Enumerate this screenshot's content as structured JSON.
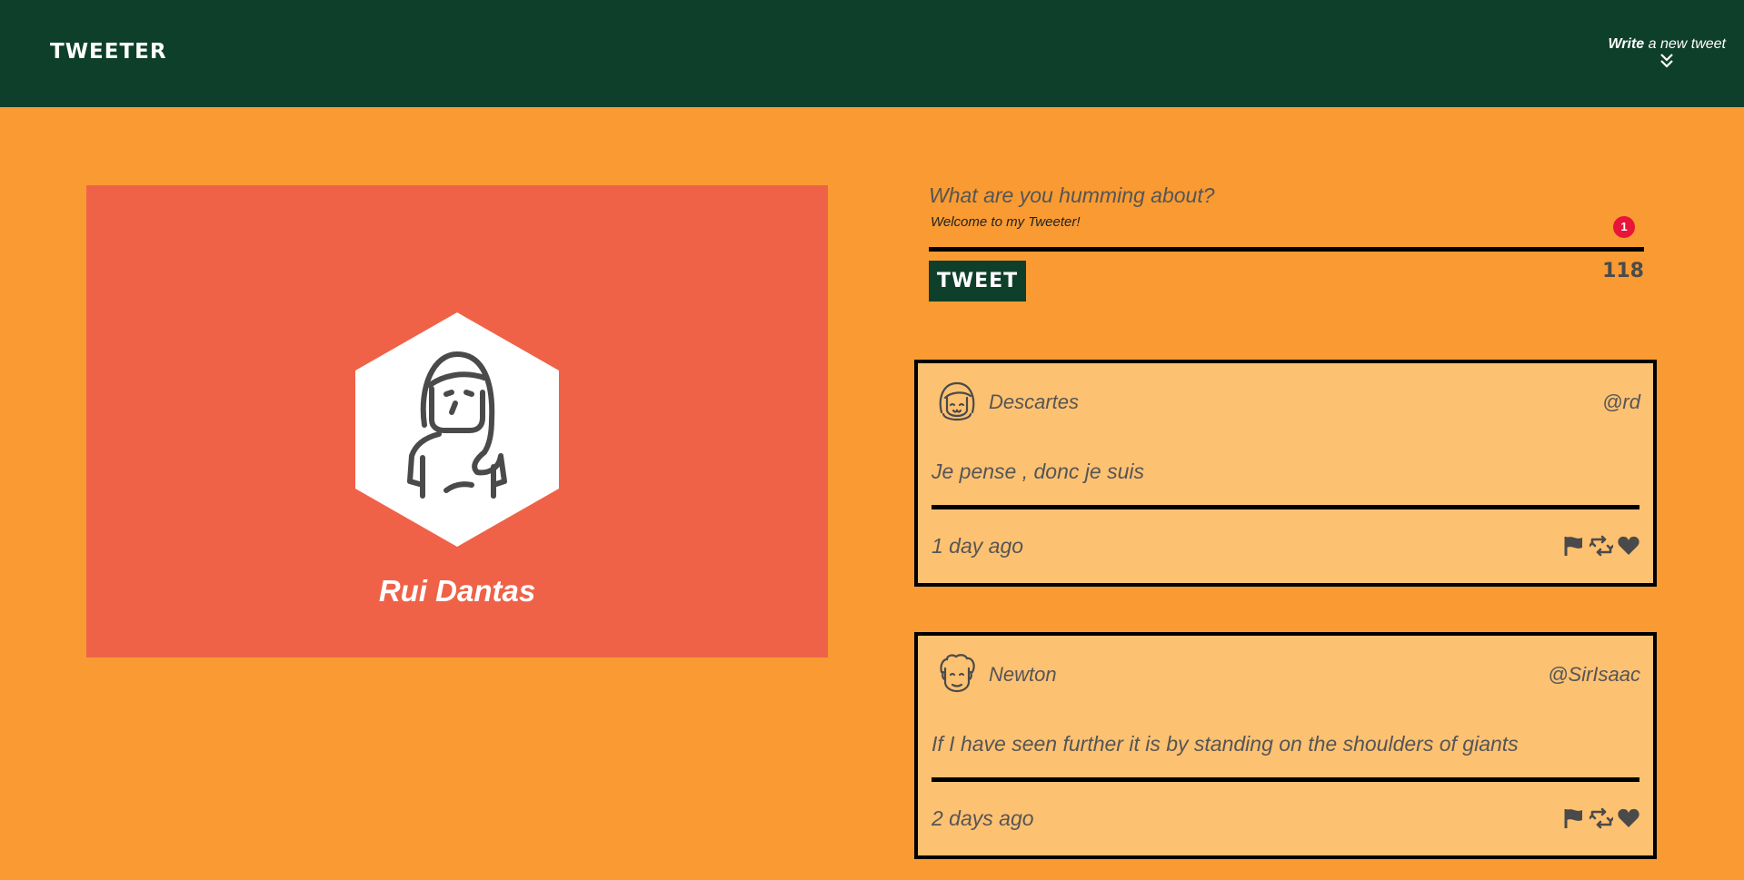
{
  "nav": {
    "brand": "TWEETER",
    "compose_toggle_bold": "Write",
    "compose_toggle_rest": " a new tweet"
  },
  "profile": {
    "name": "Rui Dantas",
    "avatar_icon": "woman-avatar-icon"
  },
  "compose": {
    "placeholder": "What are you humming about?",
    "subtitle": "Welcome to my Tweeter!",
    "badge": "1",
    "button_label": "TWEET",
    "counter": "118"
  },
  "tweets": [
    {
      "author": "Descartes",
      "handle": "@rd",
      "text": "Je pense , donc je suis",
      "time": "1 day ago",
      "avatar_icon": "girl-avatar-icon"
    },
    {
      "author": "Newton",
      "handle": "@SirIsaac",
      "text": "If I have seen further it is by standing on the shoulders of giants",
      "time": "2 days ago",
      "avatar_icon": "curly-hair-avatar-icon"
    }
  ],
  "colors": {
    "page_bg": "#f99b32",
    "nav_bg": "#0e3f2b",
    "profile_bg": "#ef6248",
    "tweet_bg": "#fdc172",
    "badge": "#e8143a",
    "icon": "#4a4a4a"
  }
}
